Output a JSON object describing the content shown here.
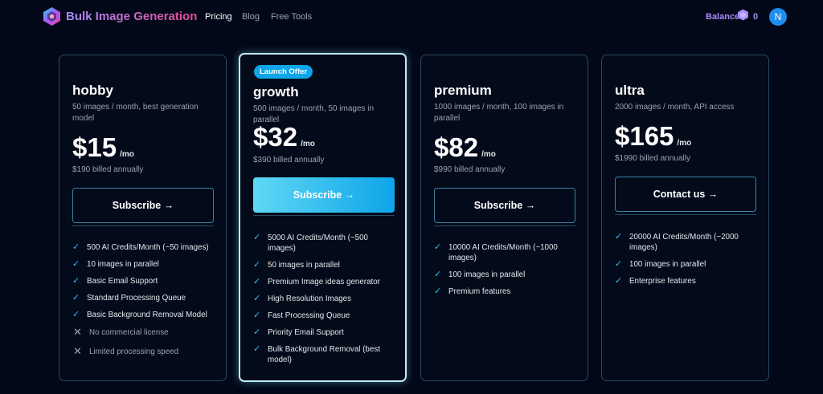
{
  "header": {
    "brand": "Bulk Image Generation",
    "nav": [
      {
        "label": "Pricing",
        "active": true
      },
      {
        "label": "Blog",
        "active": false
      },
      {
        "label": "Free Tools",
        "active": false
      }
    ],
    "balance_label": "Balance",
    "balance_value": "0",
    "avatar_initial": "N"
  },
  "plans": [
    {
      "name": "hobby",
      "description": "50 images / month, best generation model",
      "price": "$15",
      "per": "/mo",
      "billed": "$190 billed annually",
      "cta": "Subscribe →",
      "features": [
        {
          "label": "500 AI Credits/Month (~50 images)",
          "included": true
        },
        {
          "label": "10 images in parallel",
          "included": true
        },
        {
          "label": "Basic Email Support",
          "included": true
        },
        {
          "label": "Standard Processing Queue",
          "included": true
        },
        {
          "label": "Basic Background Removal Model",
          "included": true
        },
        {
          "label": "No commercial license",
          "included": false
        },
        {
          "label": "Limited processing speed",
          "included": false
        }
      ]
    },
    {
      "name": "growth",
      "badge": "Launch Offer",
      "description": "500 images / month, 50 images in parallel",
      "price": "$32",
      "per": "/mo",
      "billed": "$390 billed annually",
      "cta": "Subscribe →",
      "features": [
        {
          "label": "5000 AI Credits/Month (~500 images)",
          "included": true
        },
        {
          "label": "50 images in parallel",
          "included": true
        },
        {
          "label": "Premium Image ideas generator",
          "included": true
        },
        {
          "label": "High Resolution Images",
          "included": true
        },
        {
          "label": "Fast Processing Queue",
          "included": true
        },
        {
          "label": "Priority Email Support",
          "included": true
        },
        {
          "label": "Bulk Background Removal (best model)",
          "included": true
        }
      ]
    },
    {
      "name": "premium",
      "description": "1000 images / month, 100 images in parallel",
      "price": "$82",
      "per": "/mo",
      "billed": "$990 billed annually",
      "cta": "Subscribe →",
      "features": [
        {
          "label": "10000 AI Credits/Month (~1000 images)",
          "included": true
        },
        {
          "label": "100 images in parallel",
          "included": true
        },
        {
          "label": "Premium features",
          "included": true
        }
      ]
    },
    {
      "name": "ultra",
      "description": "2000 images / month, API access",
      "price": "$165",
      "per": "/mo",
      "billed": "$1990 billed annually",
      "cta": "Contact us →",
      "features": [
        {
          "label": "20000 AI Credits/Month (~2000 images)",
          "included": true
        },
        {
          "label": "100 images in parallel",
          "included": true
        },
        {
          "label": "Enterprise features",
          "included": true
        }
      ]
    }
  ],
  "colors": {
    "background": "#020817",
    "accent": "#0ea5e9",
    "card_border": "#2a4a63",
    "brand_gradient_start": "#a78bfa",
    "brand_gradient_end": "#ec4899"
  }
}
